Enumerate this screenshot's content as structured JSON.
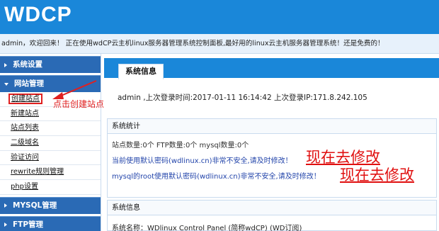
{
  "header": {
    "logo": "WDCP"
  },
  "welcome": {
    "text": "admin，欢迎回来！ 正在使用wdCP云主机linux服务器管理系统控制面板,最好用的linux云主机服务器管理系统！还是免费的！"
  },
  "sidebar": {
    "sections": [
      {
        "label": "系统设置"
      },
      {
        "label": "网站管理"
      },
      {
        "label": "MYSQL管理"
      },
      {
        "label": "FTP管理"
      }
    ],
    "site_items": [
      "创建站点",
      "新建站点",
      "站点列表",
      "二级域名",
      "验证访问",
      "rewrite规则管理",
      "php设置"
    ]
  },
  "annotation": {
    "text": "点击创建站点"
  },
  "main": {
    "tab_label": "系统信息",
    "login_line": "admin ,上次登录时间:2017-01-11 16:14:42 上次登录IP:171.8.242.105",
    "stats": {
      "title": "系统统计",
      "counts": "站点数量:0个 FTP数量:0个 mysql数量:0个",
      "warning1": "当前使用默认密码(wdlinux.cn)非常不安全,请及时修改！",
      "warning2": "mysql的root使用默认密码(wdlinux.cn)非常不安全,请及时修改！",
      "big_note1": "现在去修改",
      "big_note2": "现在去修改"
    },
    "info": {
      "title": "系统信息",
      "name_line": "系统名称：WDlinux Control Panel (简称wdCP)",
      "subscribe_link": "WD订阅"
    }
  },
  "colors": {
    "brand_blue": "#1a87d9",
    "menu_blue": "#2a6ab5",
    "annotation_red": "#e02020",
    "warning_blue": "#2244aa"
  }
}
